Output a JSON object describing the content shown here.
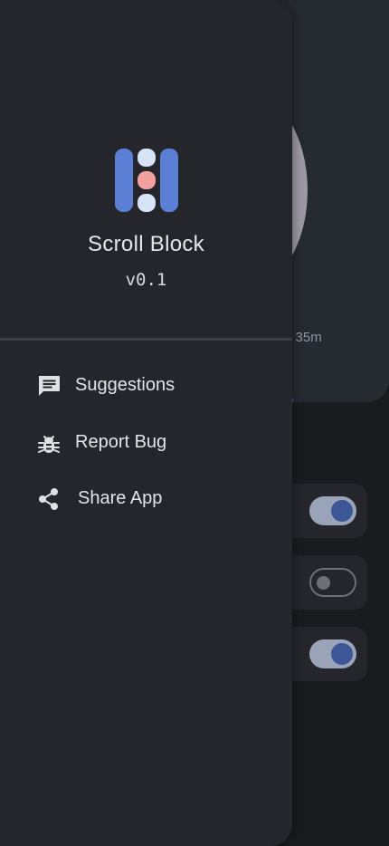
{
  "background": {
    "time_partial": "e 35m",
    "toggles": [
      "on",
      "off",
      "on"
    ]
  },
  "drawer": {
    "app_name": "Scroll Block",
    "version": "v0.1",
    "logo_colors": {
      "outer_bars": "#5b7fd4",
      "dots": "#d6e2f6",
      "center_dot": "#f3a0a0"
    },
    "menu": [
      {
        "label": "Suggestions",
        "icon": "feedback-icon"
      },
      {
        "label": "Report Bug",
        "icon": "bug-icon"
      },
      {
        "label": "Share App",
        "icon": "share-icon"
      }
    ]
  },
  "colors": {
    "drawer_bg": "#24262c",
    "screen_bg": "#1a1b1e",
    "text": "#e4e5e8",
    "toggle_on_track": "#9aa4b8",
    "toggle_on_knob": "#3d5697"
  }
}
